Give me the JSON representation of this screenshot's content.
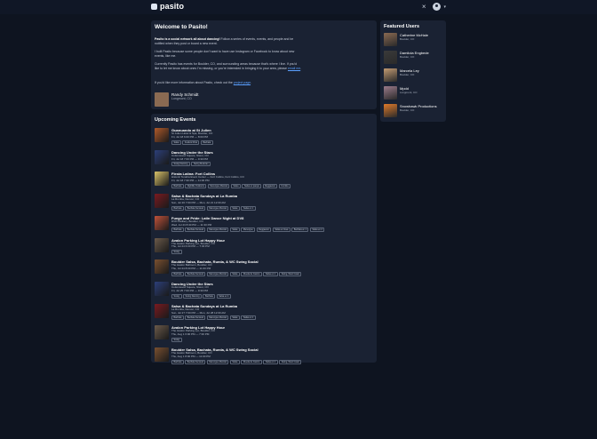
{
  "header": {
    "logo_text": "pasito",
    "close_label": "×",
    "chevron": "▾"
  },
  "welcome": {
    "title": "Welcome to Pasito!",
    "para1_lead": "Pasito is a social network all about dancing!",
    "para1_rest": " Follow a series of events, events, and people and be notified when they post or board a new event.",
    "para2": "I built Pasito because some people don't want to have use Instagram or Facebook to know about new events, like me.",
    "para3_pre": "Currently Pasito has events for Boulder, CO, and surrounding areas because that's where I live. If you'd like to let me know about ones I'm missing, or you're interested in bringing it to your area, please ",
    "para3_link": "email me",
    "para3_post": ".",
    "para4_pre": "If you'd like more information about Pasito, check out the ",
    "para4_link": "project page",
    "para4_post": ".",
    "owner": {
      "name": "Randy Schmidt",
      "location": "Longmont, CO"
    }
  },
  "events_section": {
    "title": "Upcoming Events",
    "items": [
      {
        "title": "Guanuando at St Julien",
        "venue": "St Julien Hotel & Spa, Boulder, CO",
        "when": "Fri, Jul 18 6:00 PM — 8:00 PM",
        "tags": [
          "Salsa",
          "Festival Chat",
          "Bachata"
        ],
        "img": "#b05a2a"
      },
      {
        "title": "Dancing Under the Stars",
        "venue": "Cottonwood Square, Niwot, CO",
        "when": "Fri, Jul 18 7:00 PM — 9:30 PM",
        "tags": [
          "Swing Dancing",
          "Swing Musician"
        ],
        "img": "#2c3f7a"
      },
      {
        "title": "Fiesta Latina: Fort Collins",
        "venue": "Historic Tenaha Event Center — Fort Collins, Fort Collins, CO",
        "when": "Fri, Jul 18 7:30 PM — 11:00 PM",
        "tags": [
          "Bachata",
          "Nightlife Outdoors",
          "Merengue Musical",
          "Salsa",
          "Salsa en pareja",
          "Reggaeton",
          "Cumbia"
        ],
        "img": "#d9c26a"
      },
      {
        "title": "Salsa & Bachata Sundays at La Rumba",
        "venue": "La Rumba, Denver, CO",
        "when": "Sun, Jul 20 7:00 PM — Mon, Jul 21 12:00 AM",
        "tags": [
          "Bachata",
          "Bachata Sensual",
          "Merengue Musical",
          "Salsa",
          "Salsa en 1"
        ],
        "img": "#7a1a20"
      },
      {
        "title": "Fuego and Pride: Latin Dance Night at DV8",
        "venue": "DV8 Distillery, Boulder, CO",
        "when": "Wed, Jul 23 8:30 PM — 11:30 PM",
        "tags": [
          "Bachata",
          "Bachata Sensual",
          "Merengue Musical",
          "Salsa",
          "Merengue",
          "Reggaeton",
          "Salsa en linea",
          "Bachata en 1",
          "Salsa en 2"
        ],
        "img": "#c0523a"
      },
      {
        "title": "Avalon Parking Lot Happy Hour",
        "venue": "The Avalon Parking Lot, Boulder, CO",
        "when": "Thu, Jul 24 6:00 PM — 7:30 PM",
        "tags": [
          "Swing"
        ],
        "img": "#6b5a4a"
      },
      {
        "title": "Boulder Salsa, Bachata, Rueda, & WC Swing Social",
        "venue": "The Avalon Ballroom, Boulder, CO",
        "when": "Thu, Jul 24 8:00 PM — 11:00 PM",
        "tags": [
          "Bachata",
          "Bachata Sensual",
          "Merengue Musical",
          "Salsa",
          "Rueda de Casino",
          "Salsa en 1",
          "Swing, West Coast"
        ],
        "img": "#7a5030"
      },
      {
        "title": "Dancing Under the Stars",
        "venue": "Cottonwood Square, Niwot, CO",
        "when": "Fri, Jul 25 7:00 PM — 9:30 PM",
        "tags": [
          "Swing",
          "Swing Dancing",
          "Bachata",
          "Salsa en 1"
        ],
        "img": "#2c3f7a"
      },
      {
        "title": "Salsa & Bachata Sundays at La Rumba",
        "venue": "La Rumba, Denver, CO",
        "when": "Sun, Jul 27 7:00 PM — Mon, Jul 28 12:00 AM",
        "tags": [
          "Bachata",
          "Bachata Sensual",
          "Merengue Musical",
          "Salsa",
          "Salsa en 1"
        ],
        "img": "#7a1a20"
      },
      {
        "title": "Avalon Parking Lot Happy Hour",
        "venue": "The Avalon Parking Lot, Boulder, CO",
        "when": "Thu, Aug 1 6:00 PM — 7:30 PM",
        "tags": [
          "Swing"
        ],
        "img": "#6b5a4a"
      },
      {
        "title": "Boulder Salsa, Bachata, Rueda, & WC Swing Social",
        "venue": "The Avalon Ballroom, Boulder, CO",
        "when": "Thu, Aug 1 8:00 PM — 11:00 PM",
        "tags": [
          "Bachata",
          "Bachata Sensual",
          "Merengue Musical",
          "Salsa",
          "Rueda de Casino",
          "Salsa en 1",
          "Swing, West Coast"
        ],
        "img": "#7a5030"
      }
    ]
  },
  "featured": {
    "title": "Featured Users",
    "users": [
      {
        "name": "Catherine McHale",
        "location": "Boulder, CO",
        "img": "#8a6a52"
      },
      {
        "name": "Damilola Engbede",
        "location": "Boulder, CO",
        "img": "#3a3a3a"
      },
      {
        "name": "Marcela Ley",
        "location": "Boulder, CO",
        "img": "#c29a72"
      },
      {
        "name": "Mpdd",
        "location": "Longmont, CO",
        "img": "#9a7a8a"
      },
      {
        "name": "Snowhawk Productions",
        "location": "Boulder, CO",
        "img": "#e07a2a"
      }
    ]
  },
  "colors": {
    "background": "#0e1420",
    "card": "#1a2233",
    "link": "#5aa0ff"
  }
}
